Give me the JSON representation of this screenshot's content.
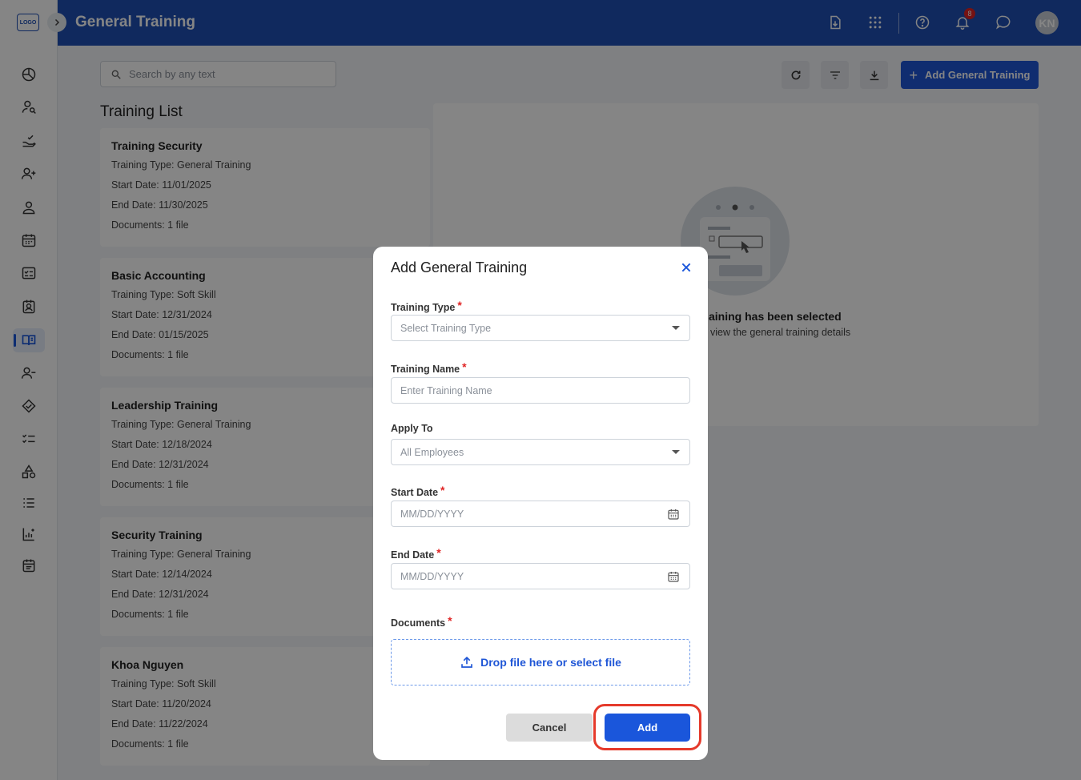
{
  "app": {
    "logo_text": "LOGO",
    "page_title": "General Training"
  },
  "header": {
    "notification_count": "8",
    "avatar_initials": "KN"
  },
  "sidebar": {
    "items": [
      {
        "icon": "chart-pie-icon"
      },
      {
        "icon": "user-search-icon"
      },
      {
        "icon": "hand-check-icon"
      },
      {
        "icon": "user-add-icon"
      },
      {
        "icon": "user-icon"
      },
      {
        "icon": "calendar-icon"
      },
      {
        "icon": "checklist-icon"
      },
      {
        "icon": "contact-card-icon"
      },
      {
        "icon": "book-open-icon",
        "active": true
      },
      {
        "icon": "user-minus-icon"
      },
      {
        "icon": "handshake-icon"
      },
      {
        "icon": "task-list-icon"
      },
      {
        "icon": "shapes-icon"
      },
      {
        "icon": "ordered-list-icon"
      },
      {
        "icon": "report-chart-icon"
      },
      {
        "icon": "calendar-list-icon"
      }
    ]
  },
  "toolbar": {
    "search_placeholder": "Search by any text",
    "add_button_label": "Add General Training"
  },
  "training_list": {
    "title": "Training List",
    "items": [
      {
        "name": "Training Security",
        "type": "Training Type: General Training",
        "start": "Start Date: 11/01/2025",
        "end": "End Date: 11/30/2025",
        "docs": "Documents: 1 file"
      },
      {
        "name": "Basic Accounting",
        "type": "Training Type: Soft Skill",
        "start": "Start Date: 12/31/2024",
        "end": "End Date: 01/15/2025",
        "docs": "Documents: 1 file"
      },
      {
        "name": "Leadership Training",
        "type": "Training Type: General Training",
        "start": "Start Date: 12/18/2024",
        "end": "End Date: 12/31/2024",
        "docs": "Documents: 1 file"
      },
      {
        "name": "Security Training",
        "type": "Training Type: General Training",
        "start": "Start Date: 12/14/2024",
        "end": "End Date: 12/31/2024",
        "docs": "Documents: 1 file"
      },
      {
        "name": "Khoa Nguyen",
        "type": "Training Type: Soft Skill",
        "start": "Start Date: 11/20/2024",
        "end": "End Date: 11/22/2024",
        "docs": "Documents: 1 file"
      }
    ]
  },
  "detail": {
    "empty_title": "aining has been selected",
    "empty_subtitle": "view the general training details"
  },
  "modal": {
    "title": "Add General Training",
    "training_type": {
      "label": "Training Type",
      "placeholder": "Select Training Type"
    },
    "training_name": {
      "label": "Training Name",
      "placeholder": "Enter Training Name"
    },
    "apply_to": {
      "label": "Apply To",
      "value": "All Employees"
    },
    "start_date": {
      "label": "Start Date",
      "placeholder": "MM/DD/YYYY"
    },
    "end_date": {
      "label": "End Date",
      "placeholder": "MM/DD/YYYY"
    },
    "documents": {
      "label": "Documents",
      "dropzone_text": "Drop file here or select file"
    },
    "cancel_label": "Cancel",
    "add_label": "Add"
  },
  "colors": {
    "header_bg": "#1f4fb4",
    "primary": "#1a56db",
    "required": "#e02424",
    "highlight": "#e53a2b"
  }
}
